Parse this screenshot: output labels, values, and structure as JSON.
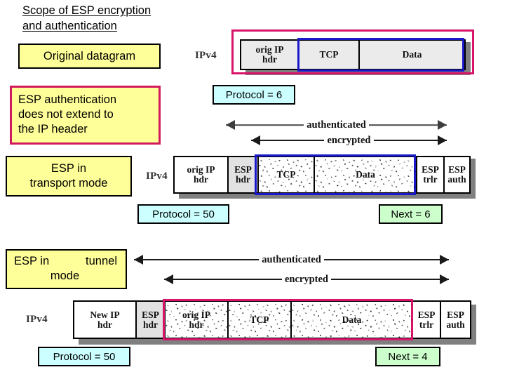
{
  "slide": {
    "title_lines": [
      "Scope of ESP encryption",
      "and authentication"
    ]
  },
  "callouts": {
    "original_datagram": "Original datagram",
    "esp_auth_note_lines": [
      "ESP authentication",
      "does not extend to",
      "the IP header"
    ],
    "transport_mode_lines": [
      "ESP in",
      "transport mode"
    ],
    "tunnel_mode_line1_a": "ESP in",
    "tunnel_mode_line1_b": "tunnel",
    "tunnel_mode_line2": "mode"
  },
  "labels": {
    "ipv4": "IPv4",
    "authenticated": "authenticated",
    "encrypted": "encrypted"
  },
  "tags": {
    "protocol_6": "Protocol = 6",
    "protocol_50_transport": "Protocol = 50",
    "next_6": "Next = 6",
    "protocol_50_tunnel": "Protocol = 50",
    "next_4": "Next = 4"
  },
  "packets": {
    "original": {
      "fields": [
        {
          "l1": "orig IP",
          "l2": "hdr"
        },
        {
          "l1": "TCP",
          "l2": ""
        },
        {
          "l1": "Data",
          "l2": ""
        }
      ]
    },
    "transport": {
      "fields": [
        {
          "l1": "orig IP",
          "l2": "hdr"
        },
        {
          "l1": "ESP",
          "l2": "hdr"
        },
        {
          "l1": "TCP",
          "l2": ""
        },
        {
          "l1": "Data",
          "l2": ""
        },
        {
          "l1": "ESP",
          "l2": "trlr"
        },
        {
          "l1": "ESP",
          "l2": "auth"
        }
      ]
    },
    "tunnel": {
      "fields": [
        {
          "l1": "New IP",
          "l2": "hdr"
        },
        {
          "l1": "ESP",
          "l2": "hdr"
        },
        {
          "l1": "orig IP",
          "l2": "hdr"
        },
        {
          "l1": "TCP",
          "l2": ""
        },
        {
          "l1": "Data",
          "l2": ""
        },
        {
          "l1": "ESP",
          "l2": "trlr"
        },
        {
          "l1": "ESP",
          "l2": "auth"
        }
      ]
    }
  },
  "colors": {
    "callout_fill": "#ffff99",
    "callout_accent_border": "#d11a5e",
    "tag_cyan": "#ccffff",
    "tag_green": "#ccffcc",
    "scope_pink": "#d9156b",
    "scope_blue": "#1a18c8",
    "shadow": "#808080"
  }
}
